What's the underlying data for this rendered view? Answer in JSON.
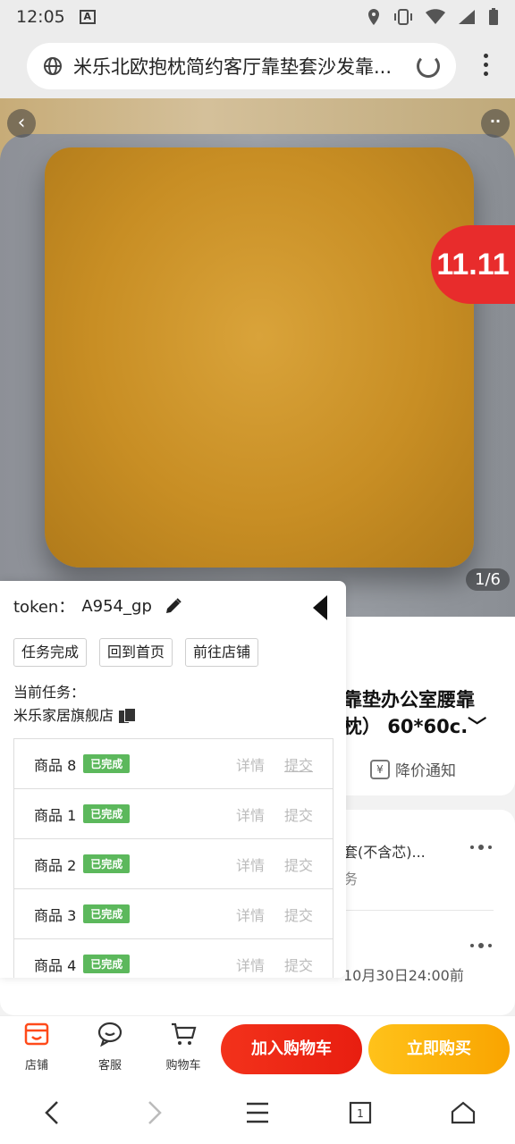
{
  "status_bar": {
    "time": "12:05",
    "notif_badge": "A"
  },
  "browser": {
    "url_title": "米乐北欧抱枕简约客厅靠垫套沙发靠..."
  },
  "product_image": {
    "pager": "1/6",
    "sale_badge": "11.11"
  },
  "background_content": {
    "title_line1": "靠垫办公室腰靠",
    "title_line2": "枕） 60*60c.﹀",
    "price_alert": "降价通知",
    "spec_line1": "套(不含芯)...",
    "spec_line2": "务",
    "delivery": "10月30日24:00前"
  },
  "panel": {
    "token_label": "token：",
    "token_value": "A954_gp",
    "buttons": [
      "任务完成",
      "回到首页",
      "前往店铺"
    ],
    "current_task_label": "当前任务：",
    "current_shop": "米乐家居旗舰店",
    "detail_label": "详情",
    "submit_label": "提交",
    "tasks": [
      {
        "name": "商品 8",
        "status": "已完成"
      },
      {
        "name": "商品 1",
        "status": "已完成"
      },
      {
        "name": "商品 2",
        "status": "已完成"
      },
      {
        "name": "商品 3",
        "status": "已完成"
      },
      {
        "name": "商品 4",
        "status": "已完成"
      }
    ]
  },
  "action_bar": {
    "shop": "店铺",
    "service": "客服",
    "cart": "购物车",
    "add_to_cart": "加入购物车",
    "buy_now": "立即购买"
  },
  "nav": {
    "tabs_count": "1"
  }
}
